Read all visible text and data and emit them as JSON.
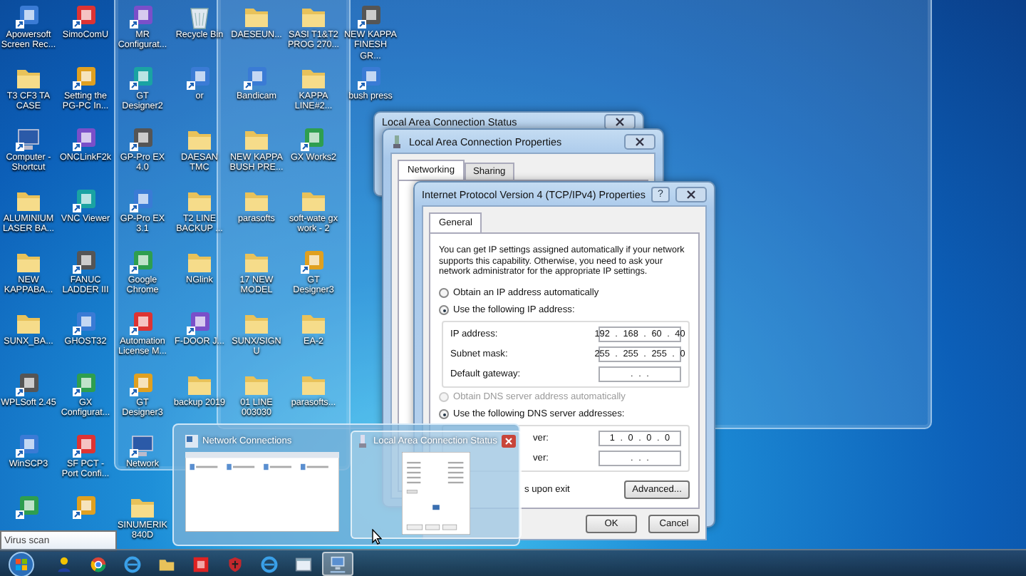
{
  "desktop_icons": [
    {
      "icons": [
        {
          "label": "Apowersoft Screen Rec...",
          "kind": "app"
        },
        {
          "label": "T3 CF3 TA CASE",
          "kind": "folder"
        },
        {
          "label": "Computer - Shortcut",
          "kind": "computer"
        },
        {
          "label": "ALUMINIUM LASER BA...",
          "kind": "folder"
        },
        {
          "label": "NEW KAPPABA...",
          "kind": "folder"
        },
        {
          "label": "SUNX_BA...",
          "kind": "folder"
        },
        {
          "label": "WPLSoft 2.45",
          "kind": "app"
        },
        {
          "label": "WinSCP3",
          "kind": "app"
        },
        {
          "kind": "app"
        }
      ]
    },
    {
      "icons": [
        {
          "label": "SimoComU",
          "kind": "app"
        },
        {
          "label": "Setting the PG-PC In...",
          "kind": "app"
        },
        {
          "label": "ONCLinkF2k",
          "kind": "app"
        },
        {
          "label": "VNC Viewer",
          "kind": "app"
        },
        {
          "label": "FANUC LADDER III",
          "kind": "app"
        },
        {
          "label": "GHOST32",
          "kind": "app"
        },
        {
          "label": "GX Configurat...",
          "kind": "app"
        },
        {
          "label": "SF PCT - Port Confi...",
          "kind": "app"
        },
        {
          "kind": "app"
        }
      ]
    },
    {
      "icons": [
        {
          "label": "MR Configurat...",
          "kind": "app"
        },
        {
          "label": "GT Designer2",
          "kind": "app"
        },
        {
          "label": "GP-Pro EX 4.0",
          "kind": "app"
        },
        {
          "label": "GP-Pro EX 3.1",
          "kind": "app"
        },
        {
          "label": "Google Chrome",
          "kind": "app"
        },
        {
          "label": "Automation License M...",
          "kind": "app"
        },
        {
          "label": "GT Designer3",
          "kind": "app"
        },
        {
          "label": "Network",
          "kind": "computer"
        },
        {
          "label": "SINUMERIK 840D",
          "kind": "folder"
        }
      ]
    },
    {
      "icons": [
        {
          "label": "Recycle Bin",
          "kind": "bin"
        },
        {
          "label": "or",
          "kind": "app"
        },
        {
          "label": "DAESAN TMC",
          "kind": "folder"
        },
        {
          "label": "T2 LINE BACKUP ...",
          "kind": "folder"
        },
        {
          "label": "NGlink",
          "kind": "folder"
        },
        {
          "label": "F-DOOR J...",
          "kind": "app"
        },
        {
          "label": "backup 2019",
          "kind": "folder"
        }
      ]
    },
    {
      "icons": [
        {
          "label": "DAESEUN...",
          "kind": "folder"
        },
        {
          "label": "Bandicam",
          "kind": "app"
        },
        {
          "label": "NEW KAPPA BUSH PRE...",
          "kind": "folder"
        },
        {
          "label": "parasofts",
          "kind": "folder"
        },
        {
          "label": "17 NEW MODEL",
          "kind": "folder"
        },
        {
          "label": "SUNX/SIGNU",
          "kind": "folder"
        },
        {
          "label": "01 LINE 003030",
          "kind": "folder"
        }
      ]
    },
    {
      "icons": [
        {
          "label": "SASI T1&T2 PROG 270...",
          "kind": "folder"
        },
        {
          "label": "KAPPA LINE#2...",
          "kind": "folder"
        },
        {
          "label": "GX Works2",
          "kind": "app"
        },
        {
          "label": "soft-wate gx work - 2",
          "kind": "folder"
        },
        {
          "label": "GT Designer3",
          "kind": "app"
        },
        {
          "label": "EA-2",
          "kind": "folder"
        },
        {
          "label": "parasofts...",
          "kind": "folder"
        }
      ]
    },
    {
      "icons": [
        {
          "label": "NEW KAPPA FINESH GR...",
          "kind": "app"
        },
        {
          "label": "bush press",
          "kind": "app"
        }
      ]
    }
  ],
  "status_window": {
    "title": "Local Area Connection Status"
  },
  "properties_window": {
    "title": "Local Area Connection Properties",
    "tabs": [
      {
        "label": "Networking",
        "selected": true
      },
      {
        "label": "Sharing",
        "selected": false
      }
    ]
  },
  "ipv4_dialog": {
    "title": "Internet Protocol Version 4 (TCP/IPv4) Properties",
    "help_button": "?",
    "tabs": [
      {
        "label": "General",
        "selected": true
      }
    ],
    "description": "You can get IP settings assigned automatically if your network supports this capability. Otherwise, you need to ask your network administrator for the appropriate IP settings.",
    "ip_options": [
      {
        "label": "Obtain an IP address automatically",
        "selected": false,
        "disabled": false
      },
      {
        "label": "Use the following IP address:",
        "selected": true,
        "disabled": false
      }
    ],
    "ip_fields": [
      {
        "label": "IP address:",
        "value": "192 . 168 . 60 . 40"
      },
      {
        "label": "Subnet mask:",
        "value": "255 . 255 . 255 . 0"
      },
      {
        "label": "Default gateway:",
        "value": ". . ."
      }
    ],
    "dns_options": [
      {
        "label": "Obtain DNS server address automatically",
        "selected": false,
        "disabled": true
      },
      {
        "label": "Use the following DNS server addresses:",
        "selected": true,
        "disabled": false
      }
    ],
    "dns_fields": [
      {
        "label": "ver:",
        "value": "1 . 0 . 0 . 0"
      },
      {
        "label": "ver:",
        "value": ". . ."
      }
    ],
    "validate_label": "s upon exit",
    "advanced_button": "Advanced...",
    "footer_buttons": [
      "OK",
      "Cancel"
    ]
  },
  "taskbar_preview": {
    "items": [
      {
        "title": "Network Connections",
        "selected": false
      },
      {
        "title": "Local Area Connection Status",
        "selected": true
      }
    ]
  },
  "tooltip": {
    "text": "Virus scan"
  },
  "taskbar": {
    "items": [
      {
        "kind": "person",
        "active": false
      },
      {
        "kind": "browser",
        "active": false
      },
      {
        "kind": "ie",
        "active": false
      },
      {
        "kind": "folder",
        "active": false
      },
      {
        "kind": "app",
        "active": false
      },
      {
        "kind": "shield",
        "active": false
      },
      {
        "kind": "ie",
        "active": false
      },
      {
        "kind": "window",
        "active": false
      },
      {
        "kind": "network",
        "active": true
      }
    ]
  }
}
